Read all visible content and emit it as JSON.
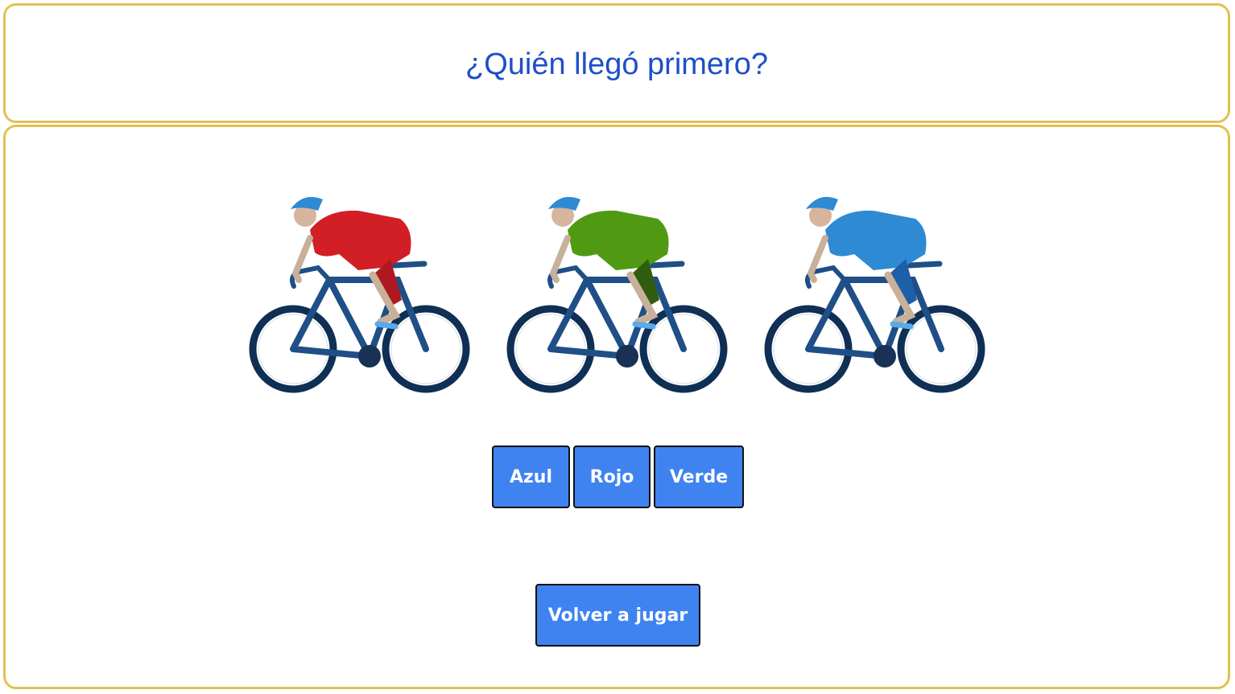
{
  "header": {
    "title": "¿Quién llegó primero?"
  },
  "cyclists": [
    {
      "jersey": "red",
      "color": "#d21f26"
    },
    {
      "jersey": "green",
      "color": "#4f9a12"
    },
    {
      "jersey": "blue",
      "color": "#2f8ad4"
    }
  ],
  "answers": {
    "azul": "Azul",
    "rojo": "Rojo",
    "verde": "Verde"
  },
  "replay_label": "Volver a jugar",
  "colors": {
    "panel_border": "#e3c150",
    "title": "#1d4fc7",
    "button": "#3f83f0",
    "bike": "#1f4f86"
  }
}
